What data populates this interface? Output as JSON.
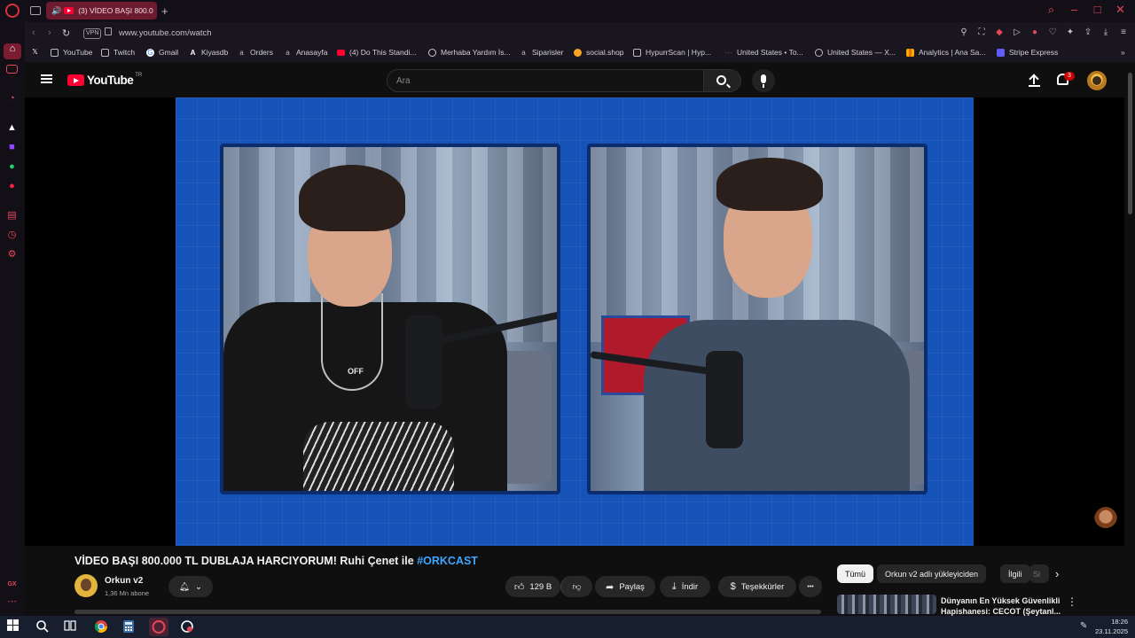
{
  "browser": {
    "tab_title": "(3) VİDEO BAŞI 800.0",
    "url": "www.youtube.com/watch",
    "vpn_label": "VPN",
    "new_tab": "+"
  },
  "bookmarks": [
    {
      "label": "YouTube",
      "icon": "page-icon"
    },
    {
      "label": "Twitch",
      "icon": "page-icon"
    },
    {
      "label": "Gmail",
      "icon": "google-icon"
    },
    {
      "label": "Kiyasdb",
      "icon": "letter-a-icon"
    },
    {
      "label": "Orders",
      "icon": "amazon-icon"
    },
    {
      "label": "Anasayfa",
      "icon": "amazon-icon"
    },
    {
      "label": "(4) Do This Standi...",
      "icon": "youtube-icon"
    },
    {
      "label": "Merhaba Yardım İs...",
      "icon": "chatgpt-icon"
    },
    {
      "label": "Siparisler",
      "icon": "amazon-icon"
    },
    {
      "label": "social.shop",
      "icon": "social-icon"
    },
    {
      "label": "HypurrScan | Hyp...",
      "icon": "hypurr-icon"
    },
    {
      "label": "United States • To...",
      "icon": "similarweb-icon"
    },
    {
      "label": "United States — X...",
      "icon": "globe-icon"
    },
    {
      "label": "Analytics | Ana Sa...",
      "icon": "analytics-icon"
    },
    {
      "label": "Stripe Express",
      "icon": "stripe-icon"
    }
  ],
  "youtube": {
    "logo_text": "YouTube",
    "logo_region": "TR",
    "search_placeholder": "Ara",
    "notification_count": "3"
  },
  "video": {
    "title_main": "VİDEO BAŞI 800.000 TL DUBLAJA HARCIYORUM! Ruhi Çenet ile ",
    "title_tag": "#ORKCAST",
    "channel_name": "Orkun v2",
    "subscribers": "1,36 Mn abone",
    "likes": "129 B",
    "share_label": "Paylaş",
    "download_label": "İndir",
    "thanks_label": "Teşekkürler",
    "more_label": "•••",
    "panel_left_text": "OFF"
  },
  "recommend_chips": [
    "Tümü",
    "Orkun v2 adlı yükleyiciden",
    "İlgili",
    "Si"
  ],
  "recommended": [
    {
      "title": "Dünyanın En Yüksek Güvenlikli Hapishanesi: CECOT (Şeytanl..."
    }
  ],
  "clock": {
    "time": "18:26",
    "date": "23.11.2025"
  },
  "sidebar_label": "GX"
}
